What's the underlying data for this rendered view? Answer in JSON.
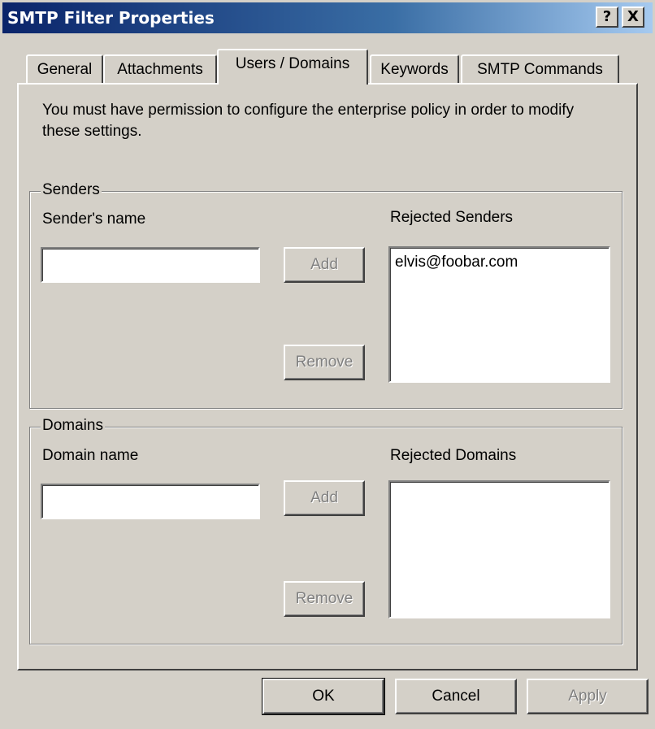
{
  "window": {
    "title": "SMTP Filter Properties",
    "help_button": "?",
    "close_button": "X"
  },
  "tabs": [
    {
      "label": "General",
      "active": false
    },
    {
      "label": "Attachments",
      "active": false
    },
    {
      "label": "Users / Domains",
      "active": true
    },
    {
      "label": "Keywords",
      "active": false
    },
    {
      "label": "SMTP Commands",
      "active": false
    }
  ],
  "notice": "You must have permission to configure the enterprise policy in order to modify these settings.",
  "senders": {
    "group_label": "Senders",
    "name_label": "Sender's name",
    "name_value": "",
    "add_label": "Add",
    "remove_label": "Remove",
    "rejected_label": "Rejected Senders",
    "rejected_items": [
      "elvis@foobar.com"
    ]
  },
  "domains": {
    "group_label": "Domains",
    "name_label": "Domain name",
    "name_value": "",
    "add_label": "Add",
    "remove_label": "Remove",
    "rejected_label": "Rejected Domains",
    "rejected_items": []
  },
  "footer": {
    "ok_label": "OK",
    "cancel_label": "Cancel",
    "apply_label": "Apply"
  },
  "colors": {
    "face": "#d4d0c8",
    "title_start": "#0a246a",
    "title_end": "#a6caf0",
    "disabled_text": "#808080"
  }
}
